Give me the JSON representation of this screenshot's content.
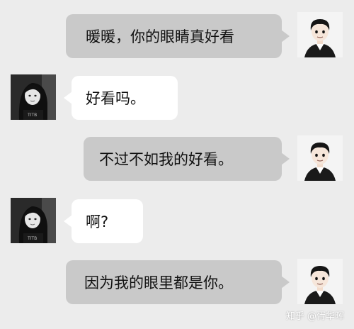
{
  "messages": [
    {
      "sender": "me",
      "text": "暖暖，你的眼睛真好看"
    },
    {
      "sender": "her",
      "text": "好看吗。"
    },
    {
      "sender": "me",
      "text": "不过不如我的好看。"
    },
    {
      "sender": "her",
      "text": "啊?"
    },
    {
      "sender": "me",
      "text": "因为我的眼里都是你。"
    }
  ],
  "watermark": "知乎 @胥华晖",
  "colors": {
    "background": "#ececec",
    "sent_bubble": "#c9c9c9",
    "received_bubble": "#ffffff"
  },
  "icons": {
    "me": "cartoon-man-avatar-icon",
    "her": "girl-photo-avatar-icon"
  }
}
